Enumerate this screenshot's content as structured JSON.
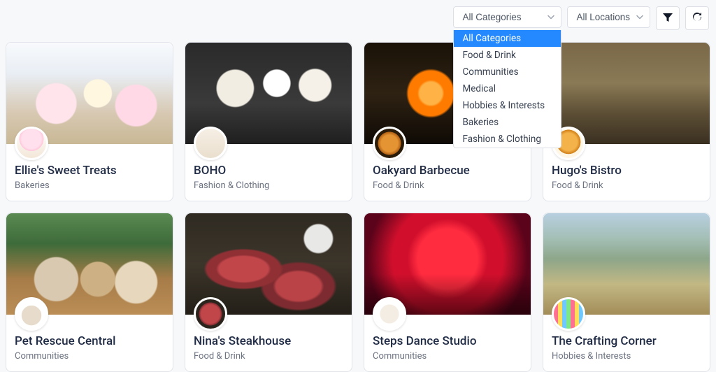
{
  "filters": {
    "category": {
      "selected": "All Categories",
      "options": [
        "All Categories",
        "Food & Drink",
        "Communities",
        "Medical",
        "Hobbies & Interests",
        "Bakeries",
        "Fashion & Clothing"
      ]
    },
    "location": {
      "selected": "All Locations"
    }
  },
  "cards": [
    {
      "title": "Ellie's Sweet Treats",
      "category": "Bakeries",
      "imgClass": "bg-cupcakes",
      "avClass": "av-cupcake"
    },
    {
      "title": "BOHO",
      "category": "Fashion & Clothing",
      "imgClass": "bg-mannequin",
      "avClass": "av-boho"
    },
    {
      "title": "Oakyard Barbecue",
      "category": "Food & Drink",
      "imgClass": "bg-bbq",
      "avClass": "av-bbq"
    },
    {
      "title": "Hugo's Bistro",
      "category": "Food & Drink",
      "imgClass": "bg-bistro",
      "avClass": "av-bistro"
    },
    {
      "title": "Pet Rescue Central",
      "category": "Communities",
      "imgClass": "bg-dogs",
      "avClass": "av-dog"
    },
    {
      "title": "Nina's Steakhouse",
      "category": "Food & Drink",
      "imgClass": "bg-steak",
      "avClass": "av-steak"
    },
    {
      "title": "Steps Dance Studio",
      "category": "Communities",
      "imgClass": "bg-dance",
      "avClass": "av-dance"
    },
    {
      "title": "The Crafting Corner",
      "category": "Hobbies & Interests",
      "imgClass": "bg-craft",
      "avClass": "av-craft"
    }
  ]
}
